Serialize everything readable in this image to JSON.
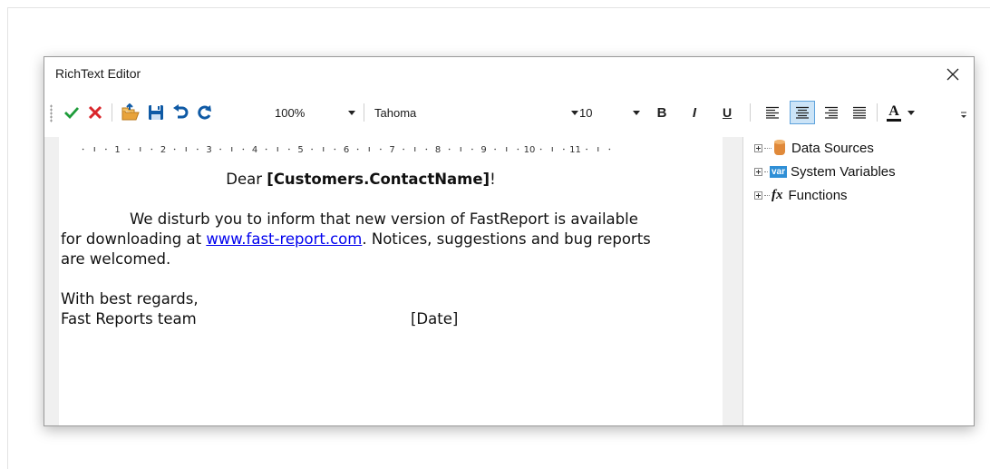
{
  "window": {
    "title": "RichText Editor"
  },
  "toolbar": {
    "zoom": "100%",
    "font_name": "Tahoma",
    "font_size": "10",
    "bold_label": "B",
    "italic_label": "I",
    "underline_label": "U",
    "font_color_label": "A",
    "icons": [
      "check-icon",
      "cancel-icon",
      "open-icon",
      "save-icon",
      "undo-icon",
      "redo-icon",
      "align-left-icon",
      "align-center-icon",
      "align-right-icon",
      "align-justify-icon",
      "font-color-icon"
    ],
    "active_alignment": "center",
    "colors": {
      "check": "#1e9c3a",
      "cancel": "#d9262b",
      "accent": "#0f5aa5",
      "active_bg": "#cce4f7"
    }
  },
  "ruler": {
    "marks": [
      "1",
      "2",
      "3",
      "4",
      "5",
      "6",
      "7",
      "8",
      "9",
      "10",
      "11"
    ]
  },
  "document": {
    "greeting_prefix": "Dear ",
    "greeting_field": "[Customers.ContactName]",
    "greeting_suffix": "!",
    "para1_indent_start": "We disturb you to inform that new version of FastReport is available",
    "para1_line2_pre": "for downloading at ",
    "para1_link": "www.fast-report.com",
    "para1_line2_post": ". Notices, suggestions and bug reports",
    "para1_line3": "are welcomed.",
    "closing": "With best regards,",
    "signature": "Fast Reports team",
    "date_field": "[Date]"
  },
  "tree": {
    "items": [
      {
        "label": "Data Sources",
        "icon": "database-icon"
      },
      {
        "label": "System Variables",
        "icon": "var-icon",
        "badge": "var"
      },
      {
        "label": "Functions",
        "icon": "fx-icon",
        "badge": "fx"
      }
    ]
  }
}
